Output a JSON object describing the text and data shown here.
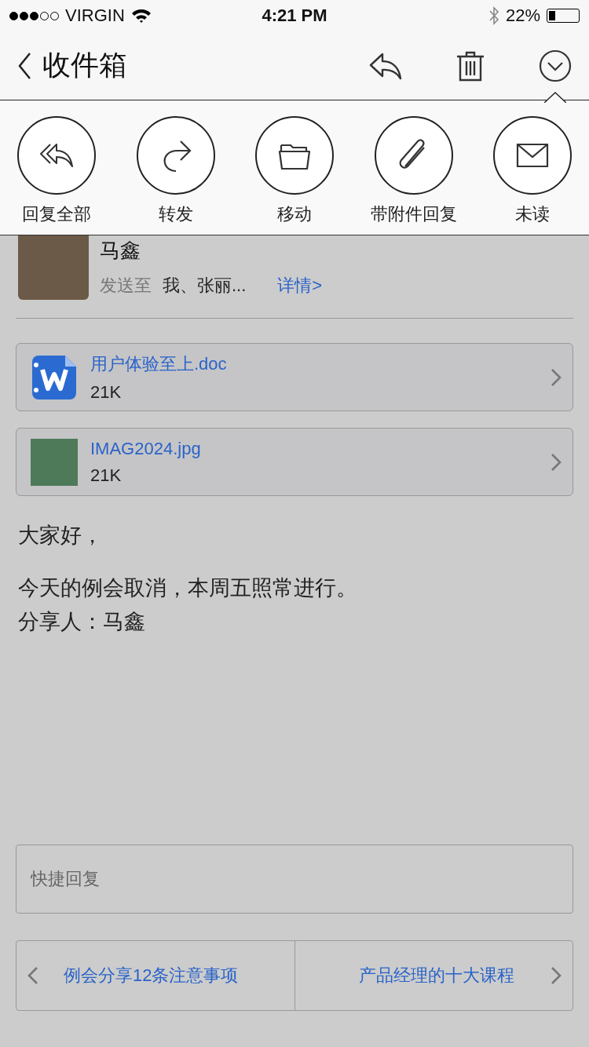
{
  "status_bar": {
    "signal_dots": [
      {
        "filled": true
      },
      {
        "filled": true
      },
      {
        "filled": true
      },
      {
        "filled": false
      },
      {
        "filled": false
      }
    ],
    "carrier": "VIRGIN",
    "time": "4:21 PM",
    "battery_text": "22%",
    "battery": {
      "level": 0.22
    }
  },
  "nav": {
    "back_label": "收件箱"
  },
  "action_menu": [
    {
      "kind": "reply-all",
      "label": "回复全部"
    },
    {
      "kind": "forward",
      "label": "转发"
    },
    {
      "kind": "move",
      "label": "移动"
    },
    {
      "kind": "attach-reply",
      "label": "带附件回复"
    },
    {
      "kind": "unread",
      "label": "未读"
    }
  ],
  "sender": {
    "name": "马鑫",
    "to_label": "发送至",
    "recipients": "我、张丽...",
    "details_link": "详情>"
  },
  "attachments": [
    {
      "kind": "doc",
      "name": "用户体验至上.doc",
      "size": "21K"
    },
    {
      "kind": "image",
      "name": "IMAG2024.jpg",
      "size": "21K"
    }
  ],
  "body": [
    [
      "大家好，"
    ],
    [
      "今天的例会取消，本周五照常进行。",
      "分享人：马鑫"
    ]
  ],
  "quick_reply": {
    "placeholder": "快捷回复"
  },
  "pager": {
    "previous": "例会分享12条注意事项",
    "next": "产品经理的十大课程"
  }
}
